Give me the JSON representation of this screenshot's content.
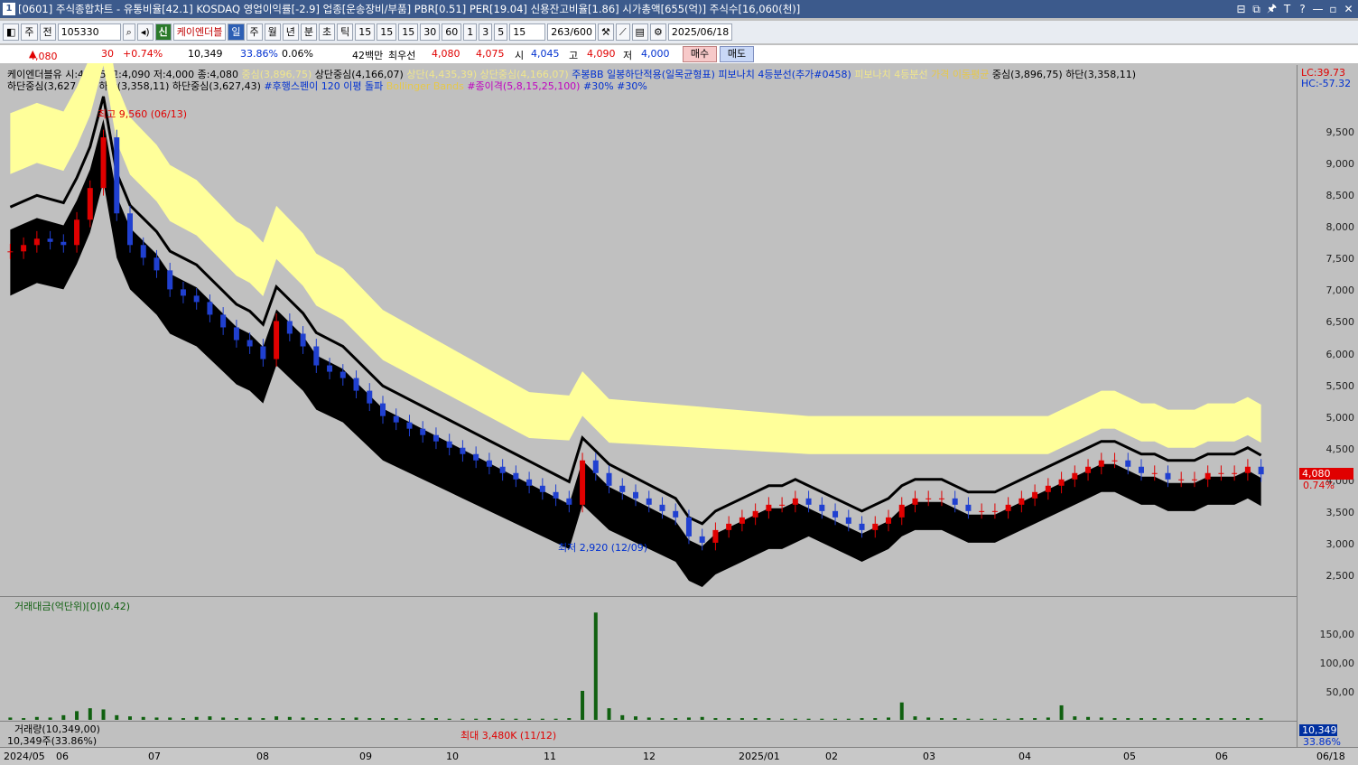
{
  "window": {
    "num": "1",
    "title": "[0601] 주식종합차트 - 유통비율[42.1] KOSDAQ 영업이익률[-2.9] 업종[운송장비/부품] PBR[0.51] PER[19.04] 신용잔고비율[1.86] 시가총액[655(억)] 주식수[16,060(천)]",
    "buttons": [
      "⊟",
      "⧉",
      "🖈",
      "T",
      "?",
      "—",
      "▫",
      "✕"
    ]
  },
  "toolbar": {
    "period_select": "주",
    "prev": "전",
    "code": "105330",
    "stock_name": "케이엔더블",
    "tabs": [
      "일",
      "주",
      "월",
      "년",
      "분",
      "초",
      "틱"
    ],
    "active_tab": "일",
    "intervals": [
      "15",
      "15",
      "15",
      "30",
      "60",
      "1",
      "3",
      "5"
    ],
    "interval_input": "15",
    "count": "263",
    "count_max": "/600",
    "date": "2025/06/18"
  },
  "quote": {
    "price": "4,080",
    "change": "30",
    "change_pct": "+0.74%",
    "volume": "10,349",
    "turnover": "33.86%",
    "rate": "0.06%",
    "amount": "42백만",
    "best_ask_label": "최우선",
    "best_ask": "4,080",
    "best_bid": "4,075",
    "open_label": "시",
    "open": "4,045",
    "high_label": "고",
    "high": "4,090",
    "low_label": "저",
    "low": "4,000",
    "buy": "매수",
    "sell": "매도"
  },
  "legend": {
    "line1": [
      {
        "text": "케이엔더블유 시:4,045 고:4,090 저:4,000 종:4,080",
        "color": "#000000"
      },
      {
        "text": "중심(3,896,75)",
        "color": "#f0e68c"
      },
      {
        "text": "상단중심(4,166,07)",
        "color": "#000000"
      },
      {
        "text": "상단(4,435,39)",
        "color": "#f0e68c"
      },
      {
        "text": "상단중심(4,166,07)",
        "color": "#f0e68c"
      },
      {
        "text": "주봉BB 일봉하단적용(일목균형표)",
        "color": "#0030d0"
      },
      {
        "text": "피보나치 4등분선(추가#0458)",
        "color": "#0030d0"
      },
      {
        "text": "피보나치 4등분선",
        "color": "#f0e68c"
      },
      {
        "text": "가격 이동평균",
        "color": "#e6c84a"
      },
      {
        "text": "중심(3,896,75)",
        "color": "#000000"
      },
      {
        "text": "하단(3,358,11)",
        "color": "#000000"
      }
    ],
    "line2": [
      {
        "text": "하단중심(3,627,43)",
        "color": "#000000"
      },
      {
        "text": "하단(3,358,11)",
        "color": "#000000"
      },
      {
        "text": "하단중심(3,627,43)",
        "color": "#000000"
      },
      {
        "text": "#후행스펜이 120 이평 돌파",
        "color": "#0030d0"
      },
      {
        "text": "Bollinger Bands",
        "color": "#e6c84a"
      },
      {
        "text": "#종이격(5,8,15,25,100)",
        "color": "#c000c0"
      },
      {
        "text": "#30%",
        "color": "#0030d0"
      },
      {
        "text": "#30%",
        "color": "#0030d0"
      }
    ],
    "lc": "LC:39.73",
    "hc": "HC:-57.32"
  },
  "annotations": {
    "high": "최고 9,560 (06/13)",
    "low": "최저 2,920 (12/09)",
    "vol_max": "최대 3,480K (11/12)",
    "price_tag": "4,080",
    "pct_tag": "0.74%"
  },
  "panels": {
    "amount_title": "거래대금(억단위)[0](0.42)",
    "volume_title": "거래량(10,349,00)",
    "volume_sub": "10,349주(33.86%)",
    "volume_tag": "10,349",
    "volume_pct": "33.86%"
  },
  "chart_data": {
    "type": "candlestick",
    "yaxis_price": [
      "9,500",
      "9,000",
      "8,500",
      "8,000",
      "7,500",
      "7,000",
      "6,500",
      "6,000",
      "5,500",
      "5,000",
      "4,500",
      "4,000",
      "3,500",
      "3,000",
      "2,500"
    ],
    "yaxis_amount": [
      "150,00",
      "100,00",
      "50,00"
    ],
    "xaxis": [
      "2024/05",
      "06",
      "07",
      "08",
      "09",
      "10",
      "11",
      "12",
      "2025/01",
      "02",
      "03",
      "04",
      "05",
      "06",
      "06/18"
    ],
    "close": [
      7600,
      7700,
      7800,
      7750,
      7700,
      8100,
      8600,
      9400,
      8200,
      7700,
      7500,
      7300,
      7000,
      6900,
      6800,
      6600,
      6400,
      6200,
      6100,
      5900,
      6500,
      6300,
      6100,
      5800,
      5700,
      5600,
      5400,
      5200,
      5000,
      4900,
      4800,
      4700,
      4600,
      4500,
      4400,
      4300,
      4200,
      4100,
      4000,
      3900,
      3800,
      3700,
      3600,
      4300,
      4100,
      3900,
      3800,
      3700,
      3600,
      3500,
      3400,
      3100,
      3000,
      3200,
      3300,
      3400,
      3500,
      3600,
      3600,
      3700,
      3600,
      3500,
      3400,
      3300,
      3200,
      3300,
      3400,
      3600,
      3700,
      3700,
      3700,
      3600,
      3500,
      3500,
      3500,
      3600,
      3700,
      3800,
      3900,
      4000,
      4100,
      4200,
      4300,
      4300,
      4200,
      4100,
      4100,
      4000,
      4000,
      4000,
      4100,
      4100,
      4100,
      4200,
      4080
    ],
    "volume_amount": [
      4,
      3,
      5,
      4,
      8,
      15,
      20,
      18,
      8,
      6,
      5,
      4,
      4,
      3,
      5,
      6,
      4,
      3,
      4,
      3,
      6,
      5,
      4,
      3,
      3,
      3,
      4,
      3,
      3,
      3,
      2,
      3,
      3,
      2,
      2,
      2,
      3,
      2,
      2,
      2,
      2,
      2,
      3,
      50,
      185,
      20,
      8,
      6,
      4,
      3,
      3,
      4,
      5,
      3,
      3,
      3,
      3,
      3,
      2,
      2,
      2,
      2,
      2,
      2,
      3,
      3,
      4,
      30,
      6,
      4,
      3,
      3,
      2,
      2,
      2,
      2,
      3,
      3,
      4,
      25,
      6,
      5,
      4,
      3,
      3,
      3,
      3,
      3,
      3,
      3,
      3,
      3,
      3,
      3,
      3
    ]
  }
}
